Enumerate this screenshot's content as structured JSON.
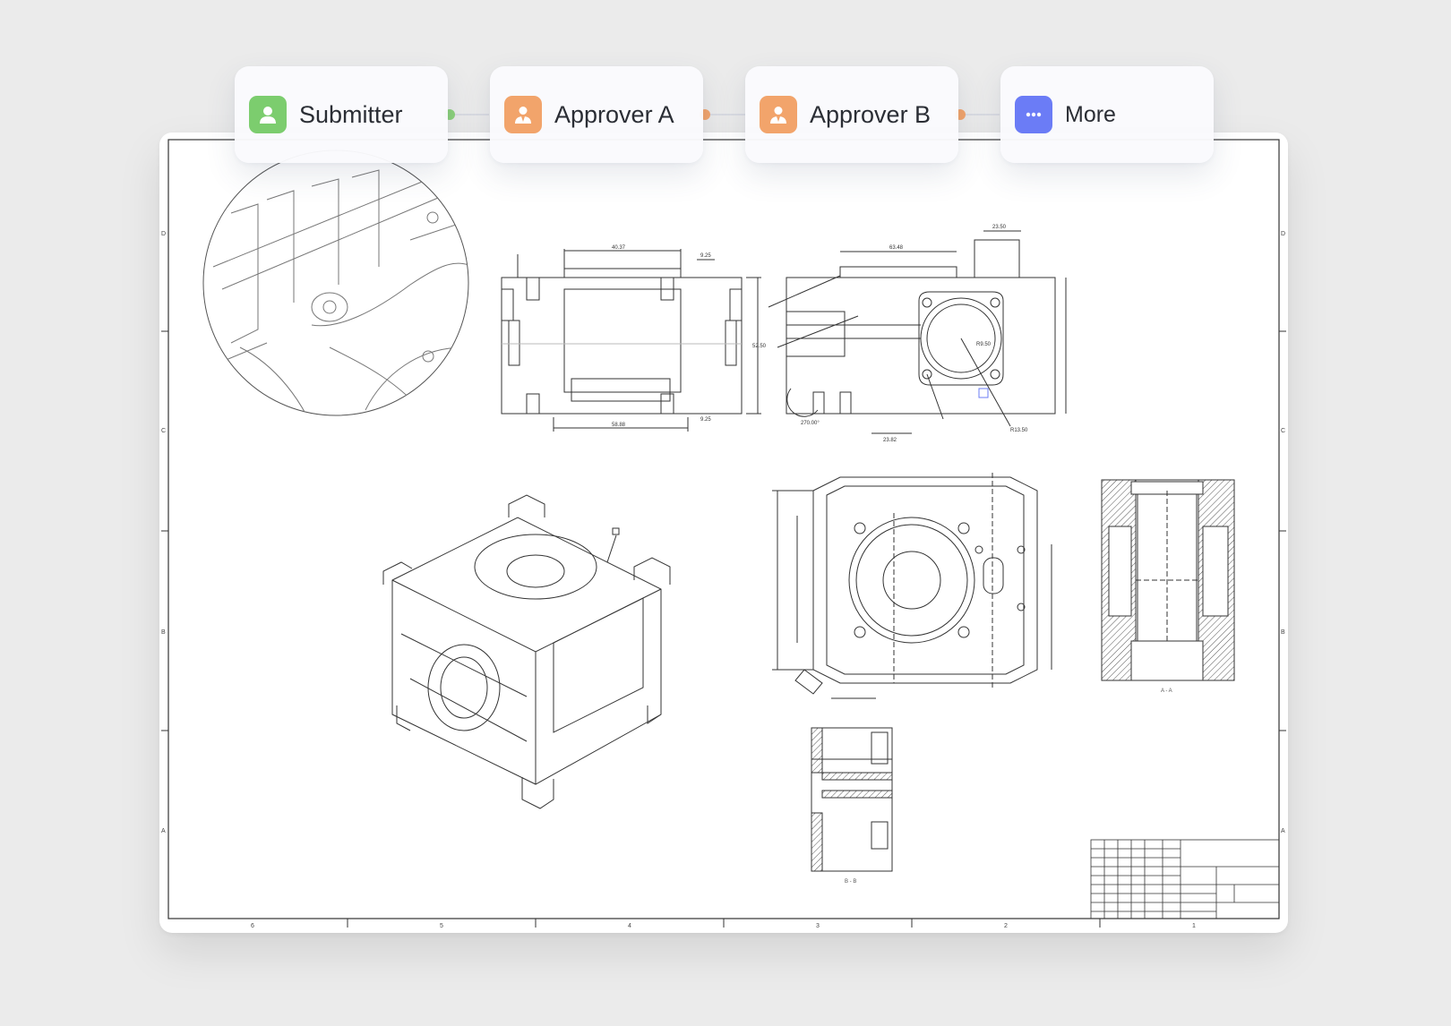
{
  "workflow": {
    "steps": [
      {
        "label": "Submitter",
        "icon": "user-icon",
        "color": "#7ccd6e"
      },
      {
        "label": "Approver A",
        "icon": "approver-icon",
        "color": "#f2a46b"
      },
      {
        "label": "Approver B",
        "icon": "approver-icon",
        "color": "#f2a46b"
      },
      {
        "label": "More",
        "icon": "more-icon",
        "color": "#6b7cf6"
      }
    ],
    "connector_colors": [
      "#8bd07a",
      "#f2a46b",
      "#f2a46b"
    ]
  },
  "drawing": {
    "frame_rows": [
      "D",
      "C",
      "B",
      "A"
    ],
    "frame_cols": [
      "6",
      "5",
      "4",
      "3",
      "2",
      "1"
    ],
    "top_view_dims": [
      "40.37",
      "9.25",
      "58.88",
      "9.25",
      "52.50"
    ],
    "side_view_dims": [
      "63.48",
      "23.50",
      "23.82",
      "270.00°",
      "R9.50",
      "R13.50"
    ],
    "section_labels": [
      "A - A",
      "B - B"
    ]
  }
}
